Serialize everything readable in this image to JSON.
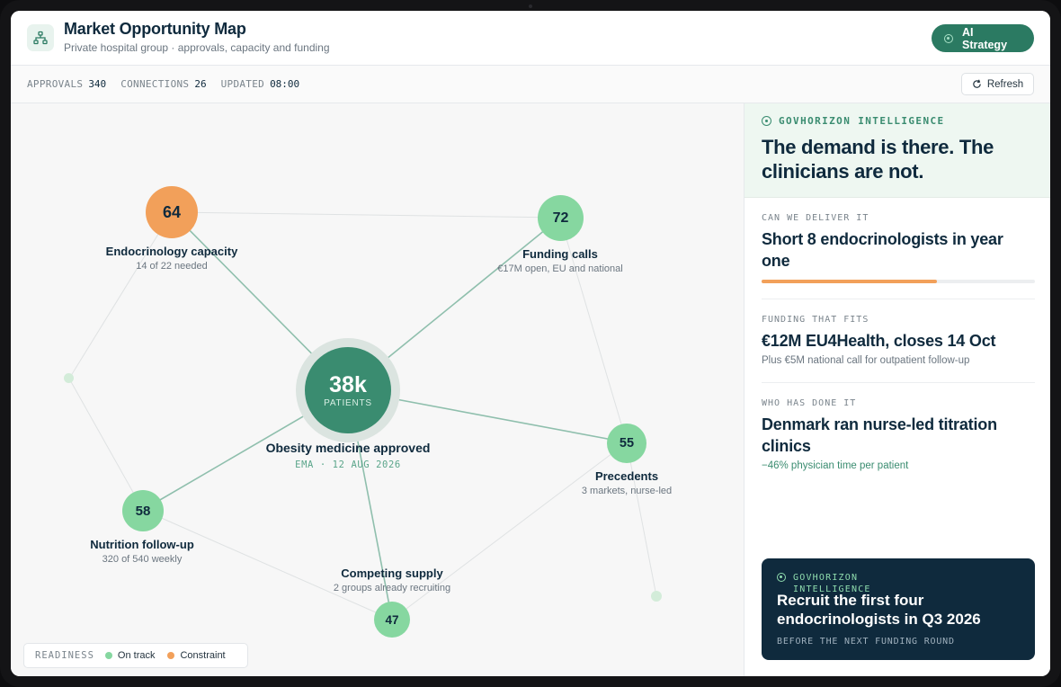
{
  "header": {
    "icon": "network-icon",
    "title": "Market Opportunity Map",
    "subtitle": "Private hospital group · approvals, capacity and funding",
    "ai_button_label": "AI Strategy"
  },
  "stats": {
    "approvals_label": "APPROVALS",
    "approvals_value": "340",
    "connections_label": "CONNECTIONS",
    "connections_value": "26",
    "updated_label": "UPDATED",
    "updated_value": "08:00",
    "refresh_label": "Refresh"
  },
  "map": {
    "center": {
      "value": "38k",
      "unit": "PATIENTS",
      "title": "Obesity medicine approved",
      "subtitle": "EMA · 12 AUG 2026"
    },
    "nodes": {
      "endocrinology": {
        "value": "64",
        "title": "Endocrinology capacity",
        "subtitle": "14 of 22 needed",
        "status": "constraint"
      },
      "funding": {
        "value": "72",
        "title": "Funding calls",
        "subtitle": "€17M open, EU and national",
        "status": "on-track"
      },
      "nutrition": {
        "value": "58",
        "title": "Nutrition follow-up",
        "subtitle": "320 of 540 weekly",
        "status": "on-track"
      },
      "precedents": {
        "value": "55",
        "title": "Precedents",
        "subtitle": "3 markets, nurse-led",
        "status": "on-track"
      },
      "competing": {
        "value": "47",
        "title": "Competing supply",
        "subtitle": "2 groups already recruiting",
        "status": "on-track"
      }
    },
    "legend": {
      "title": "READINESS",
      "on_track": "On track",
      "constraint": "Constraint"
    },
    "colors": {
      "on_track": "#86d7a0",
      "constraint": "#f2a05a",
      "center": "#3a8c70"
    }
  },
  "panel": {
    "kicker": "GOVHORIZON INTELLIGENCE",
    "headline": "The demand is there. The clinicians are not.",
    "sections": {
      "deliver": {
        "kicker": "CAN WE DELIVER IT",
        "headline": "Short 8 endocrinologists in year one",
        "progress": 0.64
      },
      "funding": {
        "kicker": "FUNDING THAT FITS",
        "headline": "€12M EU4Health, closes 14 Oct",
        "detail": "Plus €5M national call for outpatient follow-up"
      },
      "precedent": {
        "kicker": "WHO HAS DONE IT",
        "headline": "Denmark ran nurse-led titration clinics",
        "detail": "−46% physician time per patient"
      }
    },
    "cta": {
      "kicker": "GOVHORIZON INTELLIGENCE",
      "title": "Recruit the first four endocrinologists in Q3 2026",
      "footer": "BEFORE THE NEXT FUNDING ROUND"
    }
  }
}
